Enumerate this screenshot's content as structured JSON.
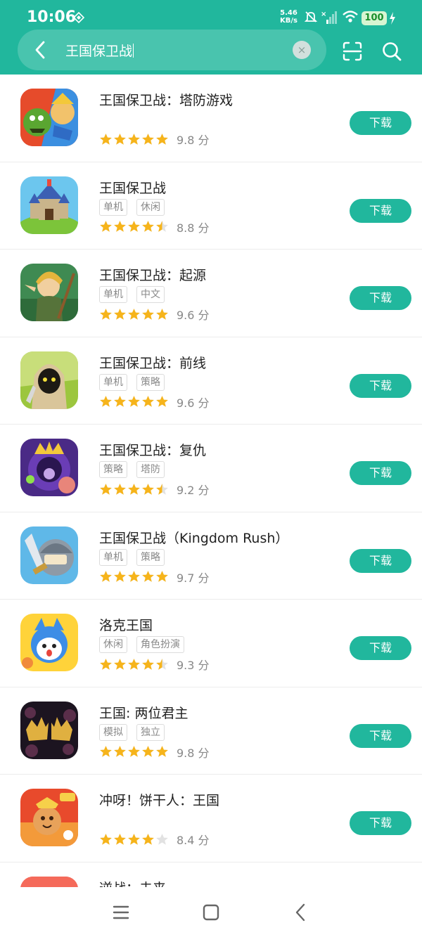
{
  "status_bar": {
    "time": "10:06",
    "net_speed_value": "5.46",
    "net_speed_unit": "KB/s",
    "battery": "100"
  },
  "search": {
    "query": "王国保卫战",
    "clear_icon": "×"
  },
  "colors": {
    "accent": "#21b79d",
    "star": "#f6b41b",
    "star_empty": "#e2e2e2"
  },
  "results": [
    {
      "title": "王国保卫战：塔防游戏",
      "tags": [],
      "stars": 5,
      "score": "9.8 分",
      "button": "下载"
    },
    {
      "title": "王国保卫战",
      "tags": [
        "单机",
        "休闲"
      ],
      "stars": 4.5,
      "score": "8.8 分",
      "button": "下载"
    },
    {
      "title": "王国保卫战：起源",
      "tags": [
        "单机",
        "中文"
      ],
      "stars": 5,
      "score": "9.6 分",
      "button": "下载"
    },
    {
      "title": "王国保卫战：前线",
      "tags": [
        "单机",
        "策略"
      ],
      "stars": 5,
      "score": "9.6 分",
      "button": "下载"
    },
    {
      "title": "王国保卫战：复仇",
      "tags": [
        "策略",
        "塔防"
      ],
      "stars": 4.5,
      "score": "9.2 分",
      "button": "下载"
    },
    {
      "title": "王国保卫战（Kingdom Rush）",
      "tags": [
        "单机",
        "策略"
      ],
      "stars": 5,
      "score": "9.7 分",
      "button": "下载"
    },
    {
      "title": "洛克王国",
      "tags": [
        "休闲",
        "角色扮演"
      ],
      "stars": 4.5,
      "score": "9.3 分",
      "button": "下载"
    },
    {
      "title": "王国: 两位君主",
      "tags": [
        "模拟",
        "独立"
      ],
      "stars": 5,
      "score": "9.8 分",
      "button": "下载"
    },
    {
      "title": "冲呀！饼干人：王国",
      "tags": [],
      "stars": 4,
      "score": "8.4 分",
      "button": "下载"
    },
    {
      "title": "逆战：未来",
      "tags": [],
      "stars": 0,
      "score": "",
      "button": ""
    }
  ],
  "icons": {
    "back": "chevron-left-icon",
    "scan": "scan-icon",
    "search": "search-icon",
    "nav_menu": "menu-icon",
    "nav_home": "home-square-icon",
    "nav_back": "back-triangle-icon"
  }
}
